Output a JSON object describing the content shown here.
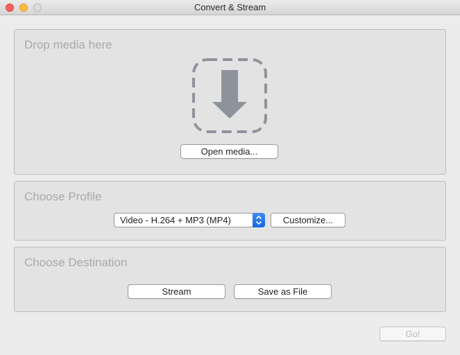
{
  "window": {
    "title": "Convert & Stream"
  },
  "drop_panel": {
    "title": "Drop media here",
    "open_button": "Open media..."
  },
  "profile_panel": {
    "title": "Choose Profile",
    "selected_profile": "Video - H.264 + MP3 (MP4)",
    "customize_button": "Customize..."
  },
  "destination_panel": {
    "title": "Choose Destination",
    "stream_button": "Stream",
    "save_button": "Save as File"
  },
  "footer": {
    "go_button": "Go!"
  },
  "colors": {
    "close": "#fc605c",
    "minimize": "#fdbc40",
    "accent": "#1565e3"
  },
  "icons": [
    "close-button",
    "minimize-button",
    "zoom-button",
    "drop-arrow-icon",
    "chevron-up-down-icon"
  ]
}
